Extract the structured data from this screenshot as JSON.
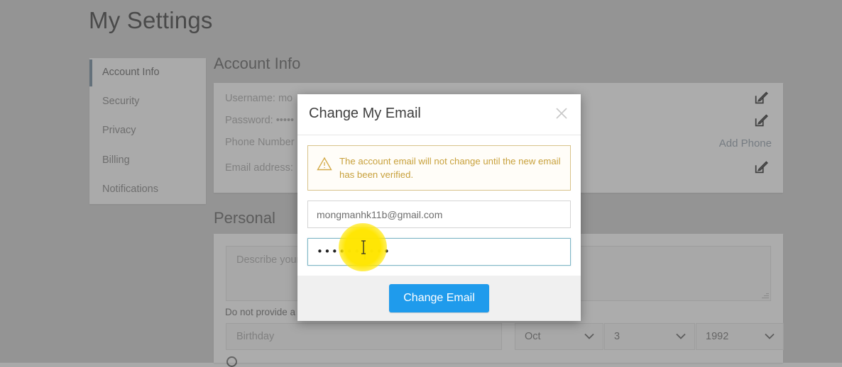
{
  "page": {
    "title": "My Settings"
  },
  "sidebar": {
    "items": [
      {
        "label": "Account Info",
        "active": true
      },
      {
        "label": "Security",
        "active": false
      },
      {
        "label": "Privacy",
        "active": false
      },
      {
        "label": "Billing",
        "active": false
      },
      {
        "label": "Notifications",
        "active": false
      }
    ]
  },
  "account_section": {
    "heading": "Account Info",
    "lines": [
      "Username: mo",
      "Password: •••••",
      "Phone Number",
      "Email address:"
    ],
    "add_phone_label": "Add Phone",
    "edit_icon": "edit-pencil-square-icon"
  },
  "personal_section": {
    "heading": "Personal",
    "bio_placeholder": "Describe your",
    "bio_note": "Do not provide a",
    "birthday_placeholder": "Birthday",
    "birth_month": "Oct",
    "birth_day": "3",
    "birth_year": "1992",
    "chevron_icon": "chevron-down-icon"
  },
  "modal": {
    "title": "Change My Email",
    "close_icon": "close-icon",
    "warning_icon": "warning-triangle-icon",
    "warning_text": "The account email will not change until the new email has been verified.",
    "email_value": "mongmanhk11b@gmail.com",
    "password_value": "••••••••••",
    "submit_label": "Change Email"
  },
  "cursor": {
    "type": "i-beam-text-cursor",
    "highlight": "click-highlight"
  },
  "colors": {
    "accent_blue": "#1f9bec",
    "sidebar_active": "#1b7bbf",
    "link_blue": "#5b87b5",
    "warning_gold": "#c8a13c",
    "focus_border": "#7fb6c6",
    "page_background": "#a9a9a9",
    "panel_background": "#d6d6d6",
    "highlight_yellow": "#ffe600"
  }
}
